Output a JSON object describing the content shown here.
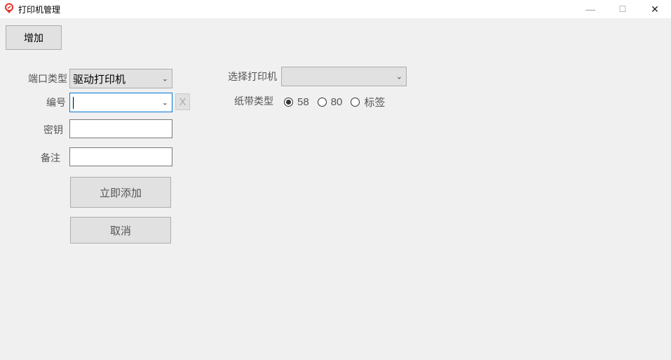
{
  "window": {
    "title": "打印机管理",
    "minimize_icon": "—",
    "maximize_icon": "☐",
    "close_icon": "✕"
  },
  "toolbar": {
    "add_label": "增加"
  },
  "form": {
    "port_type": {
      "label": "端口类型",
      "value": "驱动打印机"
    },
    "number": {
      "label": "编号",
      "value": "",
      "clear_label": "X"
    },
    "key": {
      "label": "密钥",
      "value": ""
    },
    "remark": {
      "label": "备注",
      "value": ""
    },
    "submit_label": "立即添加",
    "cancel_label": "取消",
    "printer": {
      "label": "选择打印机",
      "value": ""
    },
    "paper": {
      "label": "纸带类型",
      "options": [
        "58",
        "80",
        "标签"
      ],
      "selected": "58"
    }
  },
  "colors": {
    "accent": "#0078d7",
    "icon": "#e8302b"
  }
}
